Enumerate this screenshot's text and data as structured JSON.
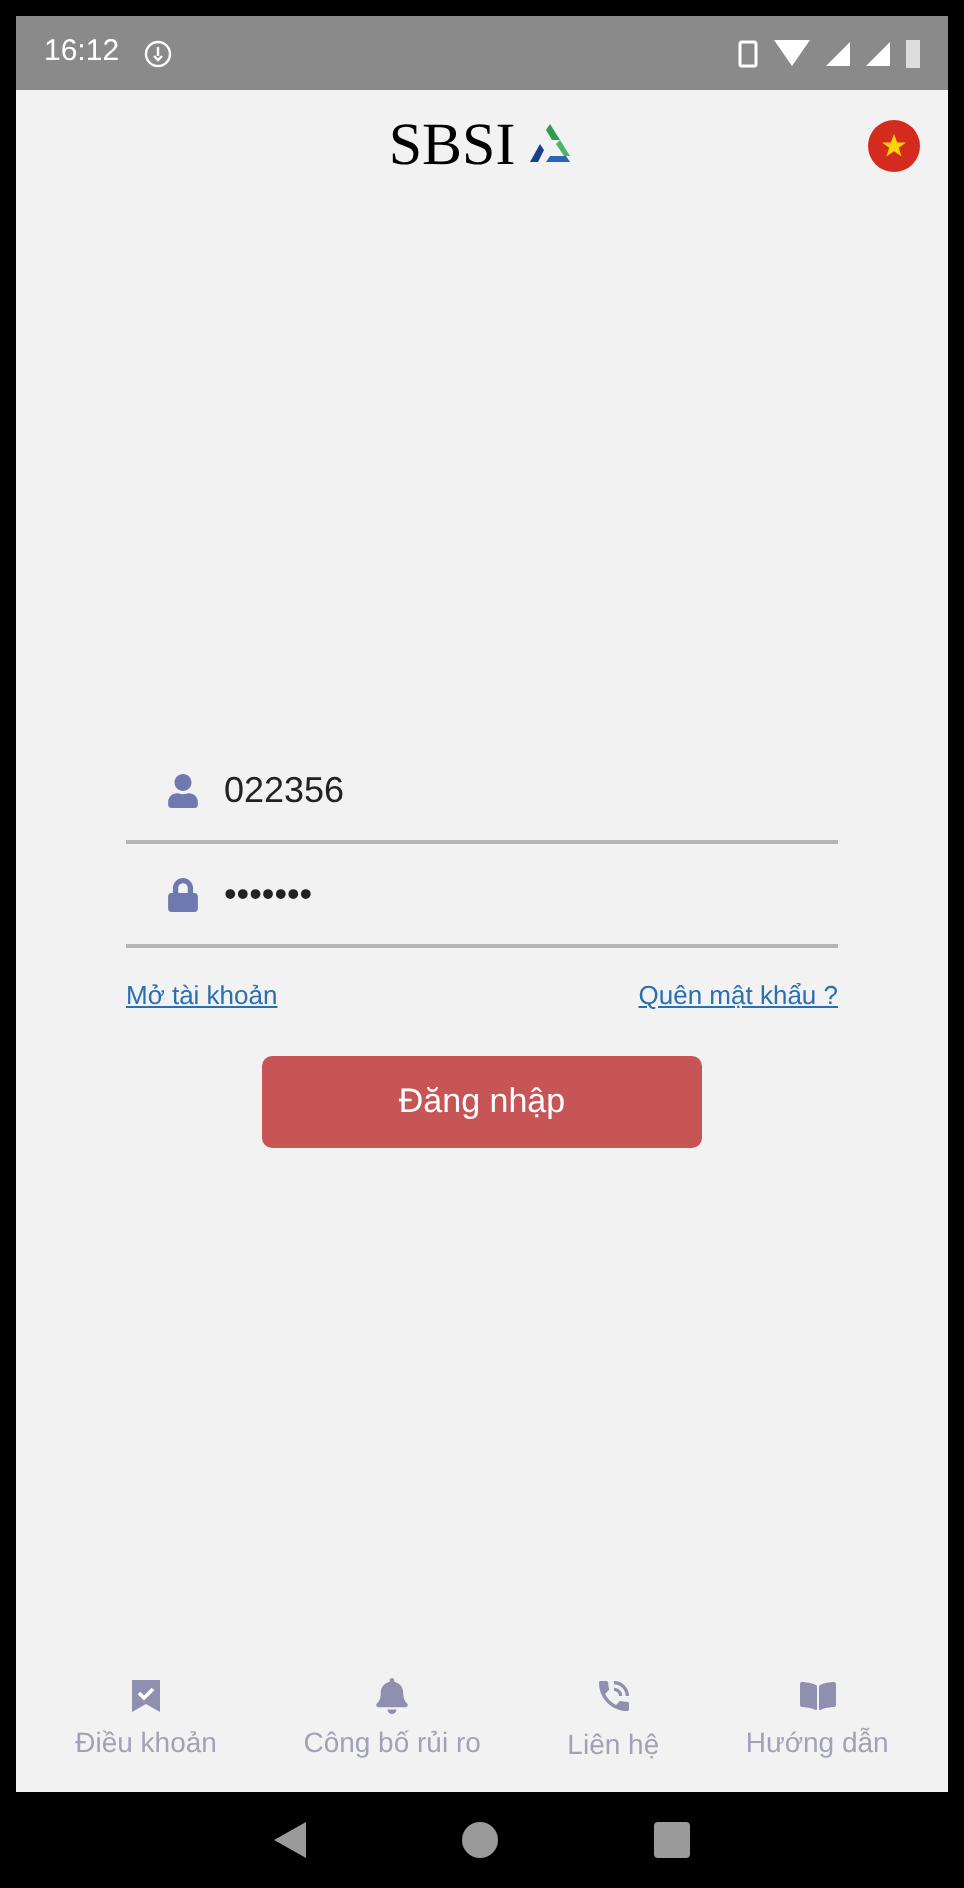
{
  "status_bar": {
    "time": "16:12"
  },
  "header": {
    "logo_text": "SBSI"
  },
  "login": {
    "username": "022356",
    "password": "•••••••"
  },
  "links": [
    "Mở tài khoản",
    "Quên mật khẩu ?"
  ],
  "login_button": "Đăng nhập",
  "bottom_nav": [
    "Điều khoản",
    "Công bố rủi ro",
    "Liên hệ",
    "Hướng dẫn"
  ]
}
